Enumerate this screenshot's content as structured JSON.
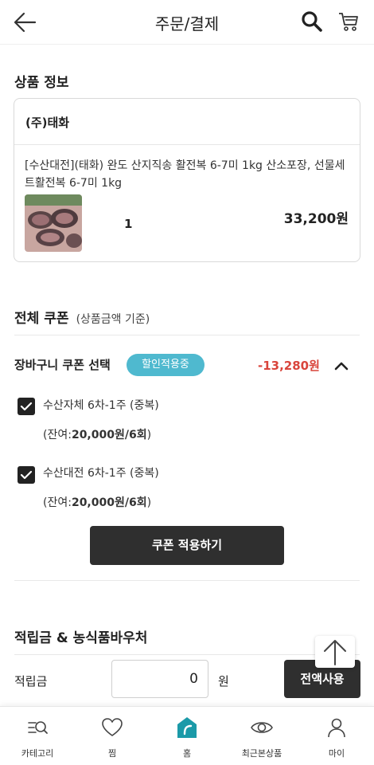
{
  "header": {
    "title": "주문/결제"
  },
  "product_section": {
    "title": "상품 정보",
    "seller": "(주)태화",
    "product_name": "[수산대전](태화) 완도 산지직송 활전복 6-7미 1kg 산소포장, 선물세트활전복 6-7미 1kg",
    "quantity": "1",
    "price": "33,200원"
  },
  "coupon_section": {
    "title": "전체 쿠폰",
    "subtitle": "(상품금액 기준)",
    "cart_coupon_label": "장바구니 쿠폰 선택",
    "badge": "할인적용중",
    "discount": "-13,280원",
    "coupons": [
      {
        "name": "수산자체 6차-1주 (중복)",
        "balance_prefix": "(잔여:",
        "balance_value": "20,000원/6회",
        "balance_suffix": ")",
        "checked": true
      },
      {
        "name": "수산대전 6차-1주 (중복)",
        "balance_prefix": "(잔여:",
        "balance_value": "20,000원/6회",
        "balance_suffix": ")",
        "checked": true
      }
    ],
    "apply_button": "쿠폰 적용하기"
  },
  "points_section": {
    "title": "적립금 & 농식품바우처",
    "points_label": "적립금",
    "points_value": "0",
    "unit": "원",
    "use_all_button": "전액사용"
  },
  "tabbar": {
    "items": [
      {
        "label": "카테고리",
        "icon": "category-search-icon"
      },
      {
        "label": "찜",
        "icon": "heart-icon"
      },
      {
        "label": "홈",
        "icon": "home-icon"
      },
      {
        "label": "최근본상품",
        "icon": "eye-icon"
      },
      {
        "label": "마이",
        "icon": "person-icon"
      }
    ]
  },
  "colors": {
    "accent": "#4fb9cf",
    "discount": "#d9453c",
    "button": "#2f2f2f",
    "home_icon": "#1b9aa8"
  }
}
